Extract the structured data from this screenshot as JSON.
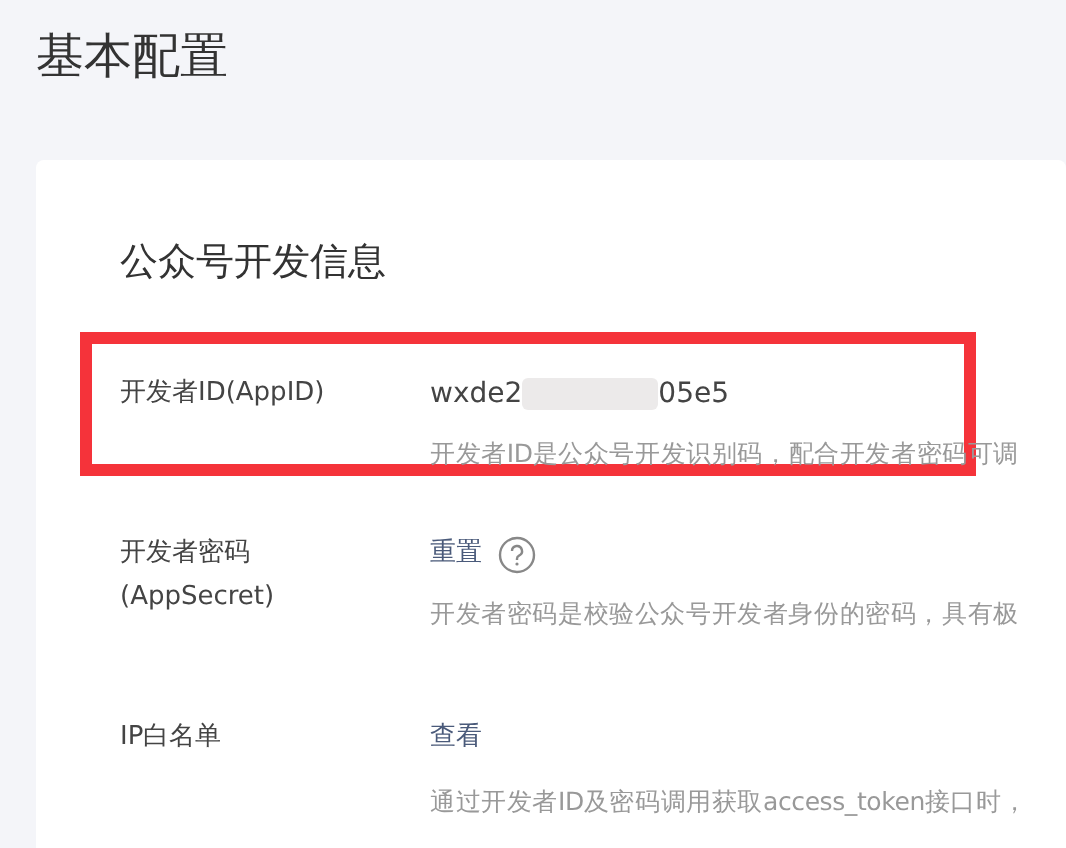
{
  "page_title": "基本配置",
  "section": {
    "title": "公众号开发信息",
    "rows": [
      {
        "kind": "id",
        "label": "开发者ID(AppID)",
        "value_start": "wxde2",
        "value_end": "05e5",
        "description": "开发者ID是公众号开发识别码，配合开发者密码可调",
        "highlighted": true
      },
      {
        "kind": "secret",
        "label_lines": [
          "开发者密码",
          "(AppSecret)"
        ],
        "action": "重置",
        "description": "开发者密码是校验公众号开发者身份的密码，具有极",
        "highlighted": false
      },
      {
        "kind": "ip",
        "label": "IP白名单",
        "action": "查看",
        "description": "通过开发者ID及密码调用获取access_token接口时，",
        "highlighted": false
      }
    ]
  }
}
